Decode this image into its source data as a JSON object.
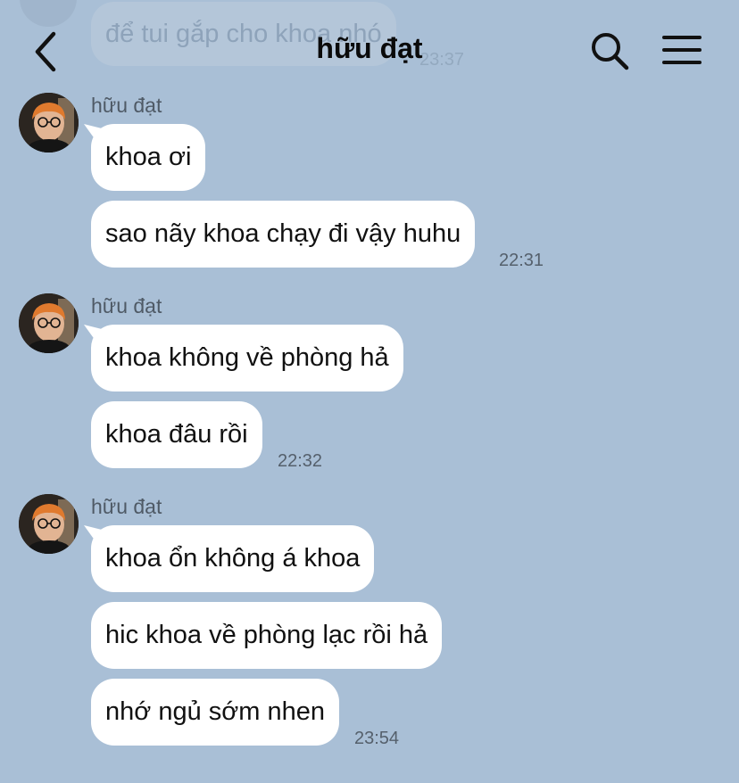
{
  "header": {
    "title": "hữu đạt",
    "back_icon": "chevron-left-icon",
    "search_icon": "search-icon",
    "menu_icon": "hamburger-menu-icon"
  },
  "previous_message": {
    "text": "để tui gắp cho khoa nhó",
    "time": "23:37"
  },
  "groups": [
    {
      "sender": "hữu đạt",
      "messages": [
        "khoa ơi",
        "sao nãy khoa chạy đi vậy huhu"
      ],
      "time": "22:31"
    },
    {
      "sender": "hữu đạt",
      "messages": [
        "khoa không về phòng hả",
        "khoa đâu rồi"
      ],
      "time": "22:32"
    },
    {
      "sender": "hữu đạt",
      "messages": [
        "khoa ổn không á khoa",
        "hic khoa về phòng lạc rồi hả",
        "nhớ ngủ sớm nhen"
      ],
      "time": "23:54"
    }
  ],
  "colors": {
    "background": "#a9bfd6",
    "bubble": "#ffffff",
    "text": "#111111",
    "meta_text": "#55606c"
  }
}
